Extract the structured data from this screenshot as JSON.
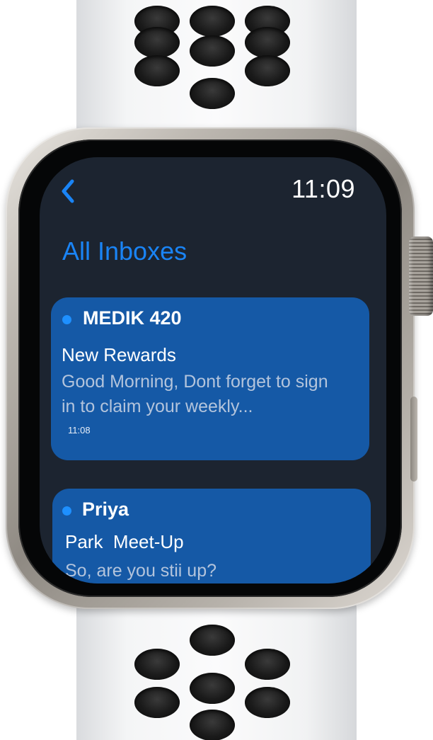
{
  "status_bar": {
    "time": "11:09"
  },
  "header": {
    "title": "All Inboxes"
  },
  "icons": {
    "back": "chevron-left-icon",
    "unread": "unread-dot-icon"
  },
  "colors": {
    "accent": "#1a84f5",
    "screen_background": "#1c2430",
    "card_background": "#1559a6",
    "unread_dot": "#1e90ff"
  },
  "messages": [
    {
      "sender": "MEDIK 420",
      "subject": "New Rewards",
      "preview": "Good Morning, Dont forget to sign in to claim your weekly...",
      "time": "11:08",
      "unread": true
    },
    {
      "sender": "Priya",
      "subject": "Park  Meet-Up",
      "preview": "So, are you stii up?",
      "unread": true
    }
  ]
}
